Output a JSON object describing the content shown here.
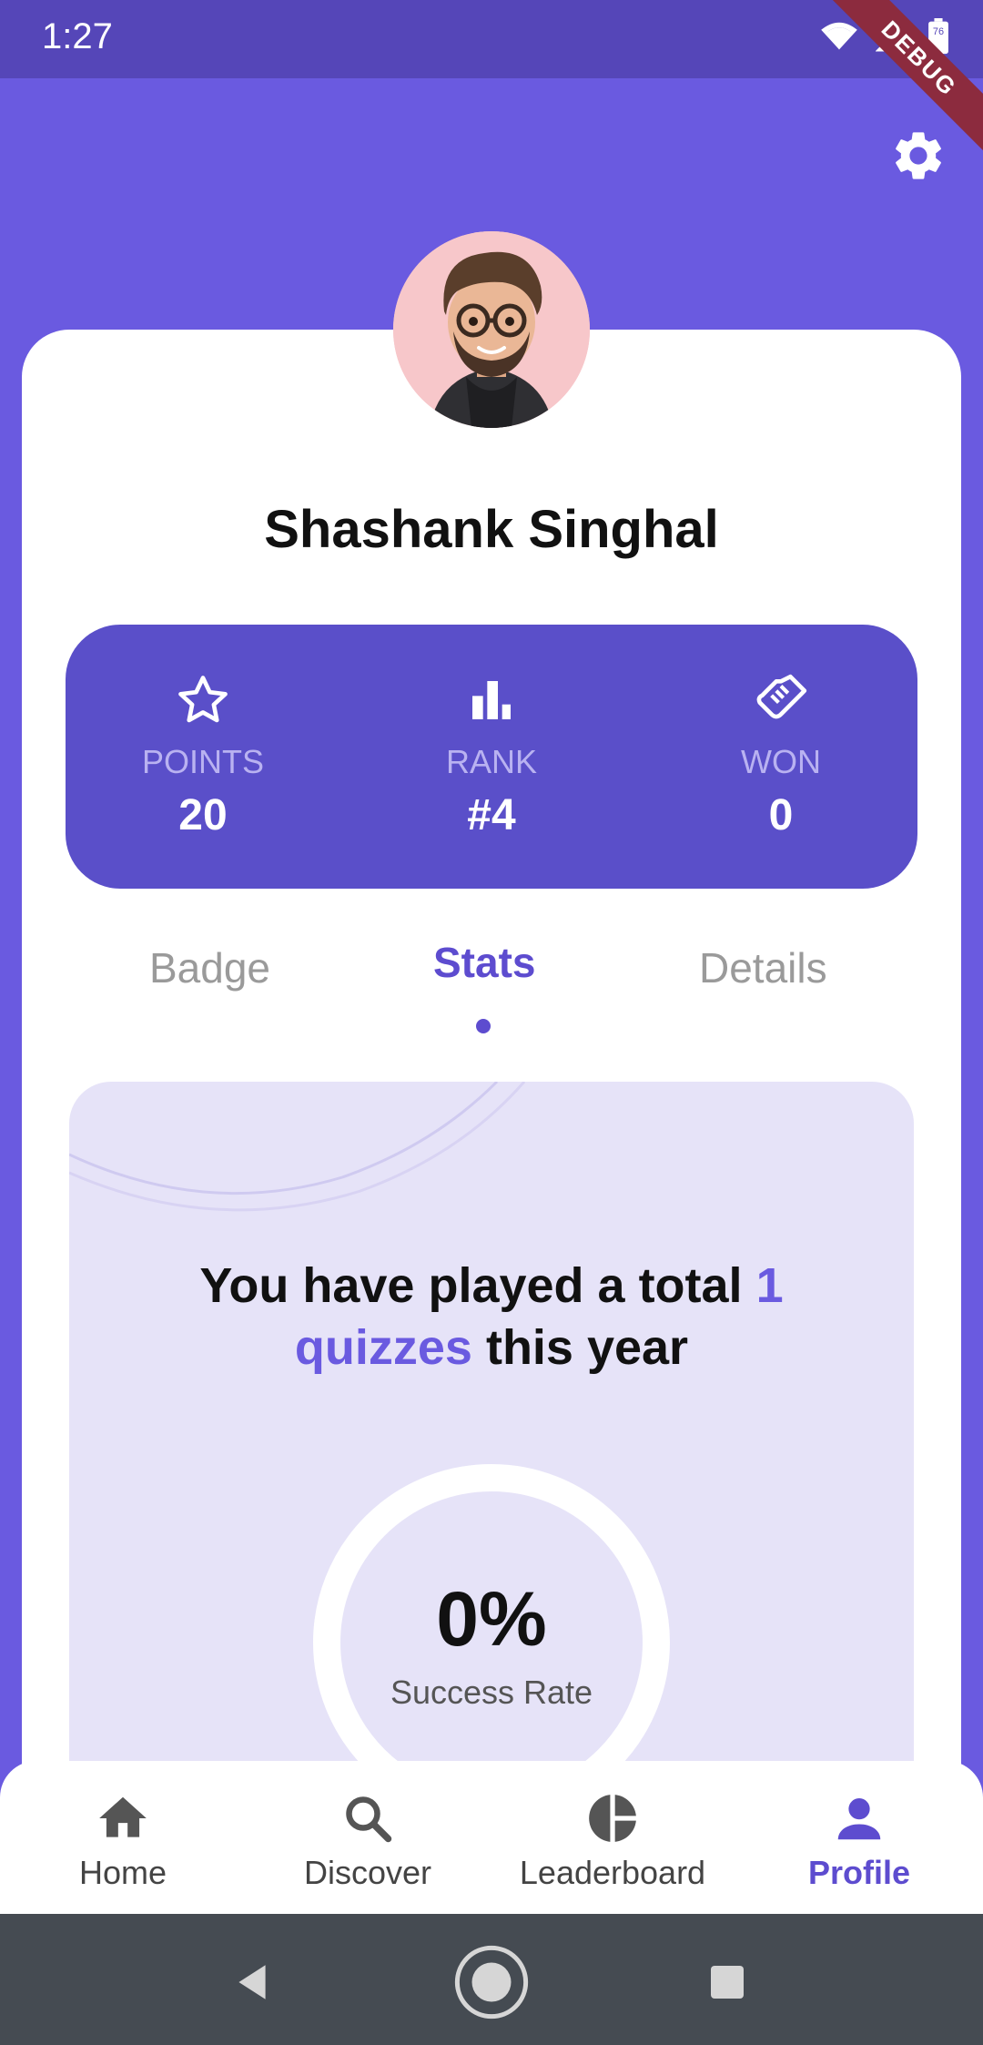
{
  "status_bar": {
    "time": "1:27",
    "battery_level": "76",
    "debug_banner": "DEBUG"
  },
  "profile": {
    "name": "Shashank Singhal",
    "avatar_description": "avatar"
  },
  "stats": [
    {
      "icon": "star-outline-icon",
      "label": "POINTS",
      "value": "20"
    },
    {
      "icon": "bar-chart-icon",
      "label": "RANK",
      "value": "#4"
    },
    {
      "icon": "handshake-icon",
      "label": "WON",
      "value": "0"
    }
  ],
  "tabs": [
    {
      "label": "Badge",
      "active": false
    },
    {
      "label": "Stats",
      "active": true
    },
    {
      "label": "Details",
      "active": false
    }
  ],
  "stats_panel": {
    "played_prefix": "You have played a total ",
    "played_count": "1",
    "played_unit": "quizzes",
    "played_suffix": " this year",
    "success_rate_value": "0%",
    "success_rate_label": "Success Rate"
  },
  "bottom_nav": [
    {
      "icon": "home-icon",
      "label": "Home",
      "active": false
    },
    {
      "icon": "search-icon",
      "label": "Discover",
      "active": false
    },
    {
      "icon": "pie-chart-icon",
      "label": "Leaderboard",
      "active": false
    },
    {
      "icon": "person-icon",
      "label": "Profile",
      "active": true
    }
  ],
  "colors": {
    "primary": "#6a5ae0",
    "stats_box": "#5a4fc9",
    "accent_text": "#5d4ccf"
  }
}
